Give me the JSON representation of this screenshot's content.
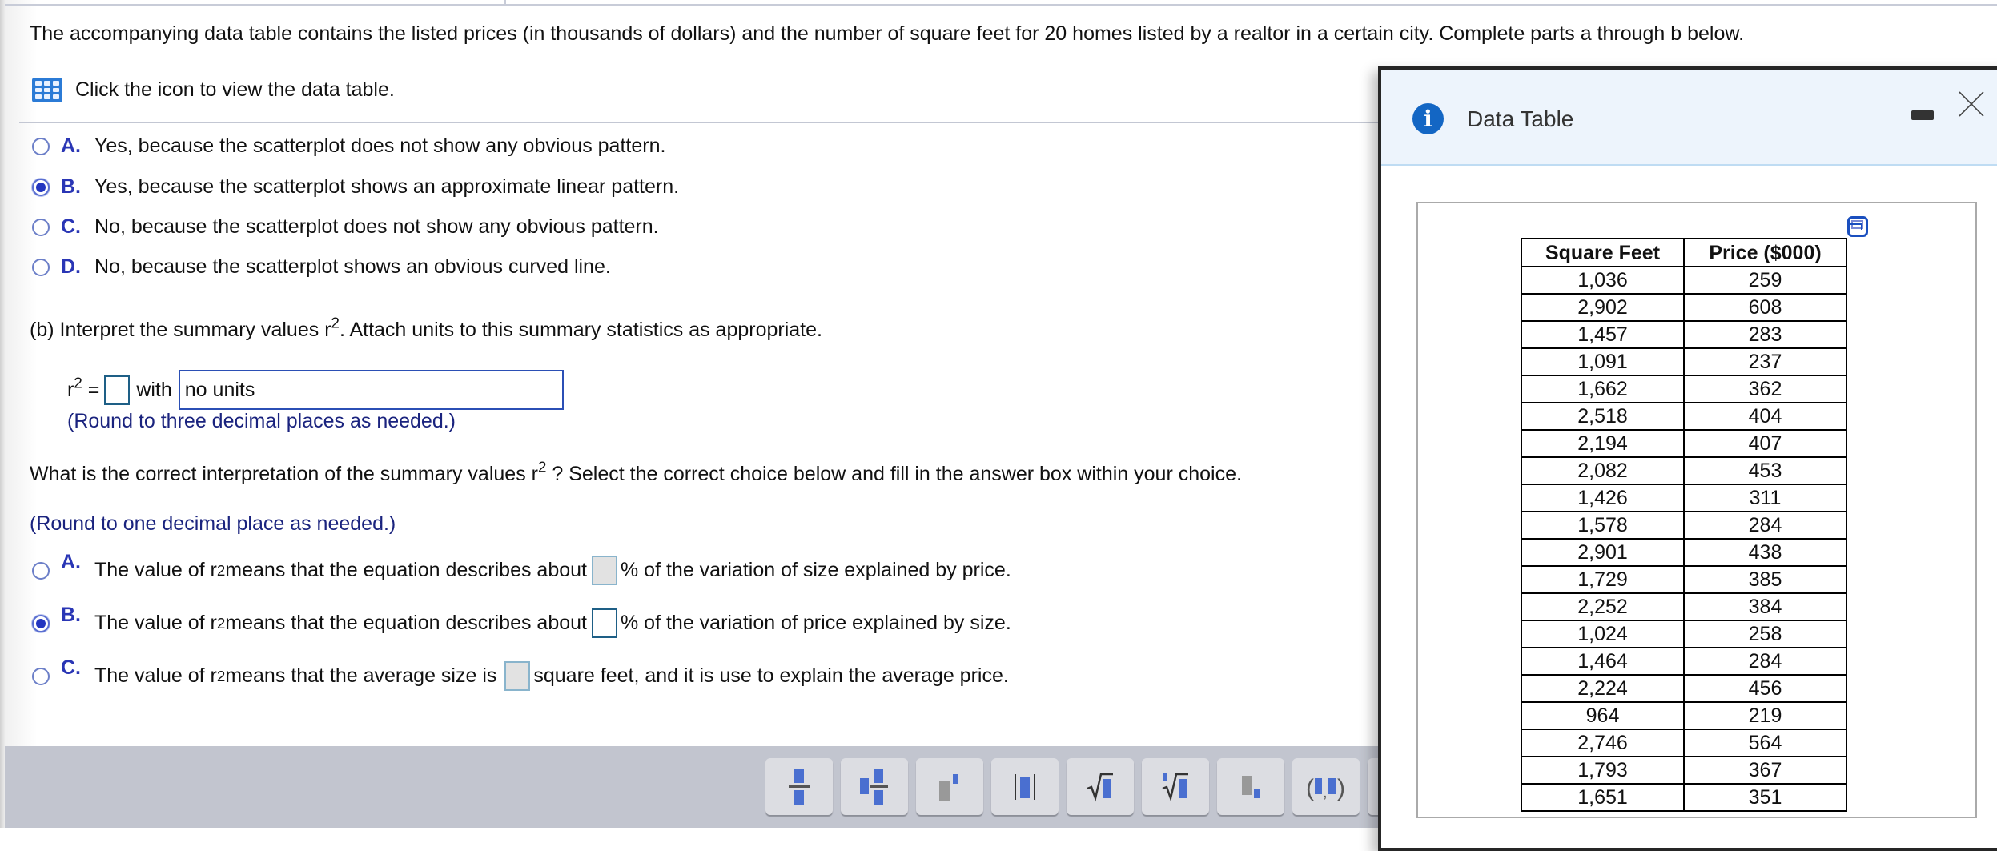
{
  "intro": "The accompanying data table contains the listed prices (in thousands of dollars) and the number of square feet for 20 homes listed by a realtor in a certain city. Complete parts a through b below.",
  "table_link": {
    "icon": "grid-table-icon",
    "label": "Click the icon to view the data table."
  },
  "part_a": {
    "options": [
      {
        "letter": "A.",
        "text": "Yes, because the scatterplot does not show any obvious pattern.",
        "selected": false
      },
      {
        "letter": "B.",
        "text": "Yes, because the scatterplot shows an approximate linear pattern.",
        "selected": true
      },
      {
        "letter": "C.",
        "text": "No, because the scatterplot does not show any obvious pattern.",
        "selected": false
      },
      {
        "letter": "D.",
        "text": "No, because the scatterplot shows an obvious curved line.",
        "selected": false
      }
    ]
  },
  "part_b": {
    "prompt_pre": "(b) Interpret the summary values r",
    "prompt_sup": "2",
    "prompt_post": ". Attach units to this summary statistics as appropriate.",
    "r2_label": "r",
    "r2_sup": "2",
    "r2_eq": " =",
    "r2_value": "",
    "with_label": "with",
    "units_value": "no units",
    "round_hint_1": "(Round to three decimal places as needed.)",
    "question_pre": "What is the correct interpretation of the summary values r",
    "question_sup": "2",
    "question_post": " ? Select the correct choice below and fill in the answer box within your choice.",
    "round_hint_2": "(Round to one decimal place as needed.)",
    "choices": [
      {
        "letter": "A.",
        "pre": "The value of r",
        "sup": "2",
        "mid": " means that the equation describes about",
        "value": "",
        "post": "% of the variation of size explained by price.",
        "selected": false
      },
      {
        "letter": "B.",
        "pre": "The value of r",
        "sup": "2",
        "mid": " means that the equation describes about",
        "value": "",
        "post": "% of the variation of price explained by size.",
        "selected": true
      },
      {
        "letter": "C.",
        "pre": "The value of r",
        "sup": "2",
        "mid": " means that the average size is",
        "value": "",
        "post": " square feet, and it is use to explain the average price.",
        "selected": false
      }
    ]
  },
  "toolbar": {
    "buttons": [
      "fraction",
      "mixed-number",
      "exponent",
      "absolute-value",
      "square-root",
      "nth-root",
      "subscript",
      "ordered-pair"
    ]
  },
  "dialog": {
    "title": "Data Table",
    "icon": "info-icon",
    "minimize": "minimize-icon",
    "close": "close-icon",
    "columns": [
      "Square Feet",
      "Price ($000)"
    ],
    "rows": [
      [
        "1,036",
        "259"
      ],
      [
        "2,902",
        "608"
      ],
      [
        "1,457",
        "283"
      ],
      [
        "1,091",
        "237"
      ],
      [
        "1,662",
        "362"
      ],
      [
        "2,518",
        "404"
      ],
      [
        "2,194",
        "407"
      ],
      [
        "2,082",
        "453"
      ],
      [
        "1,426",
        "311"
      ],
      [
        "1,578",
        "284"
      ],
      [
        "2,901",
        "438"
      ],
      [
        "1,729",
        "385"
      ],
      [
        "2,252",
        "384"
      ],
      [
        "1,024",
        "258"
      ],
      [
        "1,464",
        "284"
      ],
      [
        "2,224",
        "456"
      ],
      [
        "964",
        "219"
      ],
      [
        "2,746",
        "564"
      ],
      [
        "1,793",
        "367"
      ],
      [
        "1,651",
        "351"
      ]
    ]
  },
  "colors": {
    "accent": "#2a36b5",
    "hint": "#1a237e",
    "info": "#1366c4",
    "toolbar_bg": "#c2c5cf",
    "dialog_header": "#edf4fc"
  }
}
